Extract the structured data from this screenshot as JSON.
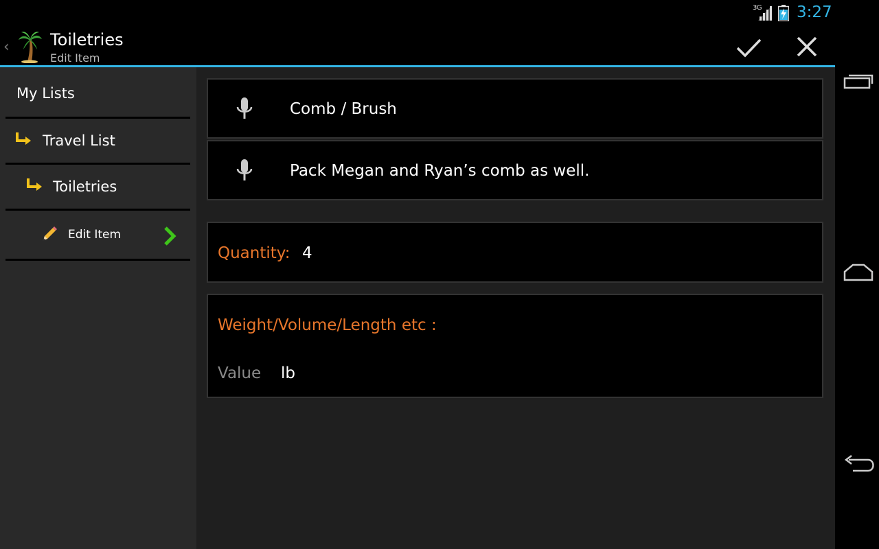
{
  "status_bar": {
    "network": "3G",
    "time": "3:27",
    "accent_color": "#33b5e5"
  },
  "action_bar": {
    "title": "Toiletries",
    "subtitle": "Edit Item",
    "up_icon": "chevron-left-icon",
    "app_icon": "palm-tree-icon",
    "done_icon": "check-icon",
    "cancel_icon": "close-icon"
  },
  "sidebar": {
    "items": [
      {
        "label": "My Lists",
        "icon": null
      },
      {
        "label": "Travel List",
        "icon": "subdirectory-arrow-icon"
      },
      {
        "label": "Toiletries",
        "icon": "subdirectory-arrow-icon"
      },
      {
        "label": "Edit Item",
        "icon": "pencil-icon",
        "trailing_icon": "chevron-right-icon"
      }
    ]
  },
  "form": {
    "name": {
      "value": "Comb / Brush",
      "icon": "microphone-icon"
    },
    "note": {
      "value": "Pack Megan and Ryan’s comb as well.",
      "icon": "microphone-icon"
    },
    "quantity": {
      "label": "Quantity:",
      "value": "4"
    },
    "measure": {
      "label": "Weight/Volume/Length etc :",
      "value_placeholder": "Value",
      "unit": "lb"
    },
    "label_color": "#e8762b"
  },
  "nav_bar": {
    "recents_icon": "recent-apps-icon",
    "home_icon": "home-icon",
    "back_icon": "back-icon"
  }
}
